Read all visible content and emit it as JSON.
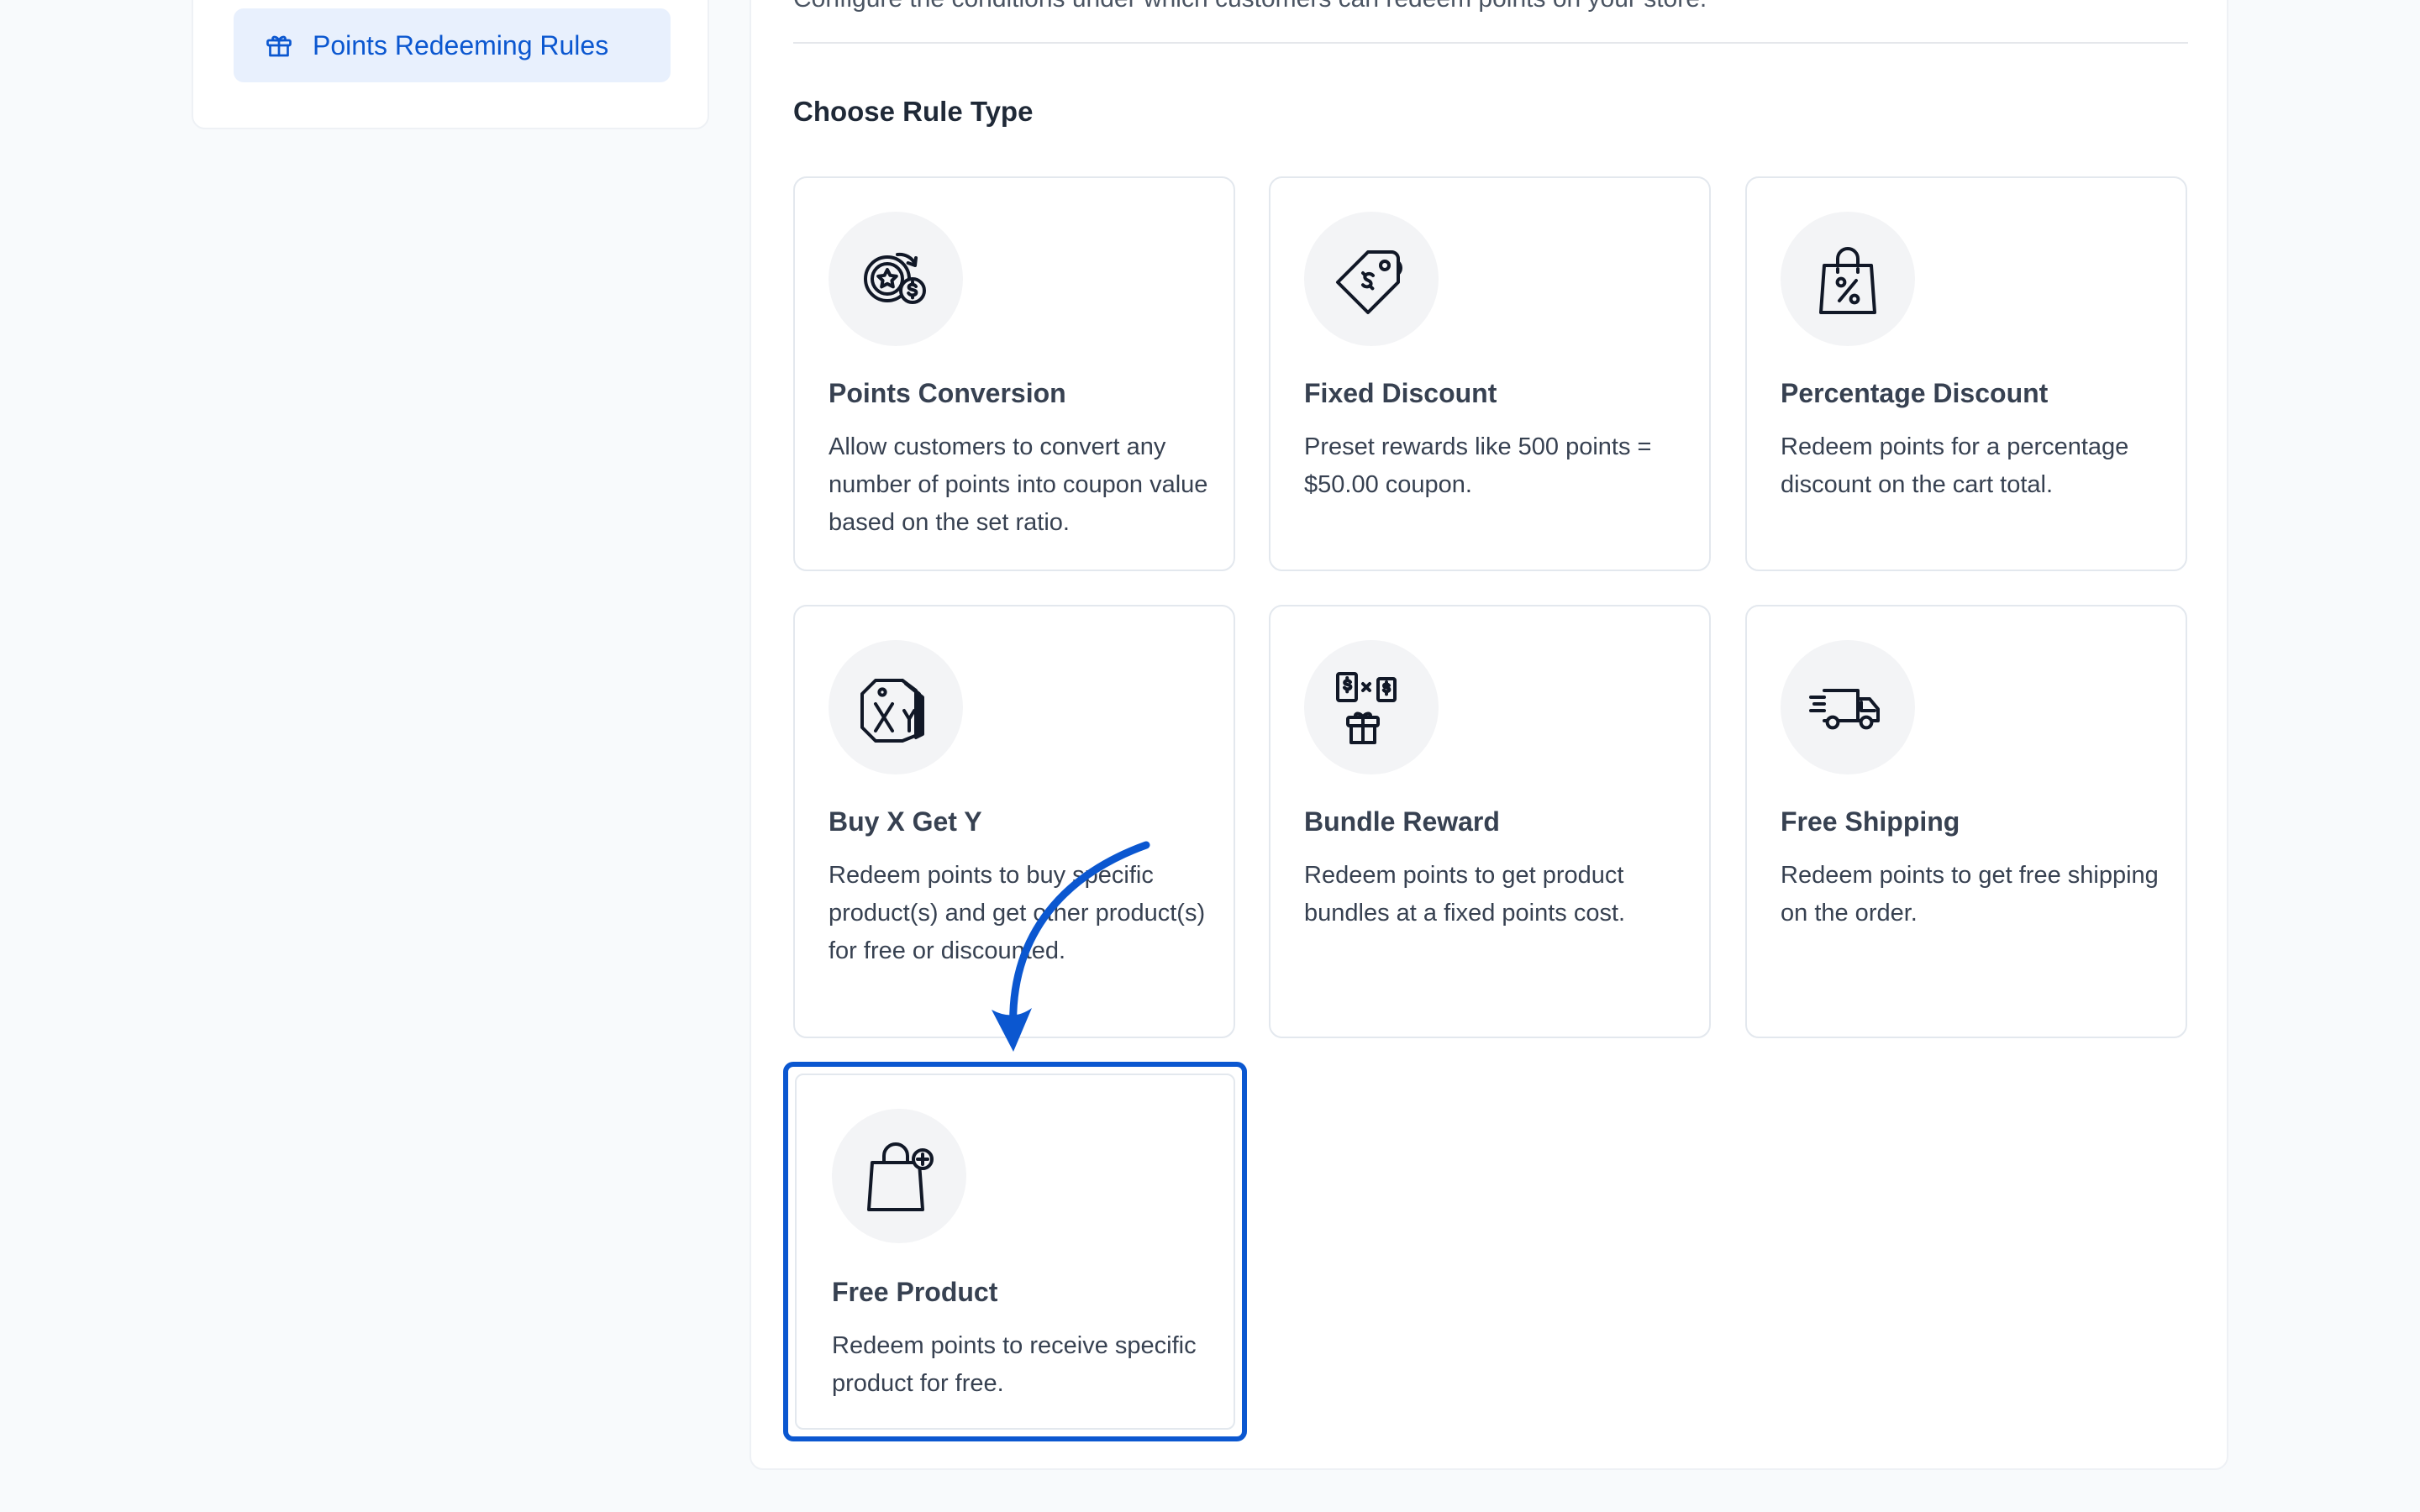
{
  "sidebar": {
    "active_item": {
      "label": "Points Redeeming Rules",
      "icon": "gift-icon"
    }
  },
  "main": {
    "subtitle": "Configure the conditions under which customers can redeem points on your store.",
    "section_title": "Choose Rule Type",
    "cards": [
      {
        "title": "Points Conversion",
        "description": "Allow customers to convert any number of points into coupon value based on the set ratio.",
        "icon": "points-conversion-icon"
      },
      {
        "title": "Fixed Discount",
        "description": "Preset rewards like 500 points = $50.00 coupon.",
        "icon": "price-tag-dollar-icon"
      },
      {
        "title": "Percentage Discount",
        "description": "Redeem points for a percentage discount on the cart total.",
        "icon": "shopping-bag-percent-icon"
      },
      {
        "title": "Buy X Get Y",
        "description": "Redeem points to buy specific product(s) and get other product(s) for free or discounted.",
        "icon": "buy-x-get-y-tags-icon"
      },
      {
        "title": "Bundle Reward",
        "description": "Redeem points to get product bundles at a fixed points cost.",
        "icon": "bundle-gift-icon"
      },
      {
        "title": "Free Shipping",
        "description": "Redeem points to get free shipping on the order.",
        "icon": "delivery-truck-icon"
      },
      {
        "title": "Free Product",
        "description": "Redeem points to receive specific product for free.",
        "icon": "shopping-bag-plus-icon"
      }
    ]
  },
  "colors": {
    "accent": "#0b57d0",
    "active_bg": "#e8f0fd",
    "card_border": "#e3e8ee",
    "icon_bg": "#f3f4f6"
  }
}
